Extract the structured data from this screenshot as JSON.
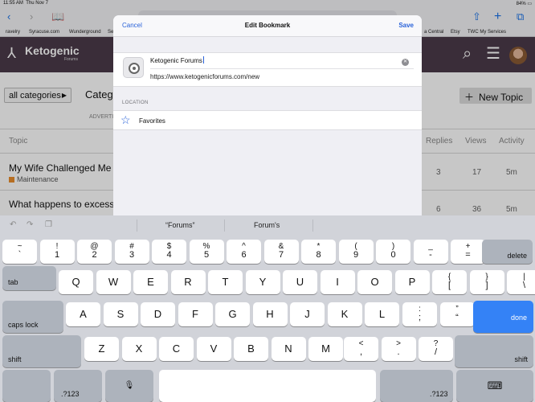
{
  "status_bar": {
    "time": "11:55 AM",
    "date": "Thu Nov 7",
    "battery": "84%"
  },
  "toolbar": {
    "back_icon": "chevron-left-icon",
    "forward_icon": "chevron-right-icon",
    "bookmarks_icon": "book-icon",
    "share_icon": "share-icon",
    "new_tab_icon": "plus-icon",
    "tabs_icon": "tabs-icon"
  },
  "favorites_bar": [
    "ravelry",
    "Syracuse.com",
    "Wunderground",
    "Se",
    "a Central",
    "Etsy",
    "TWC My Services"
  ],
  "site": {
    "brand": "Ketogenic",
    "brand_sub": "Forums"
  },
  "page": {
    "category_button": "all categories",
    "category_heading": "Categ",
    "advert": "ADVERTI",
    "new_topic": "New Topic",
    "columns": {
      "topic": "Topic",
      "replies": "Replies",
      "views": "Views",
      "activity": "Activity"
    },
    "rows": [
      {
        "title": "My Wife Challenged Me",
        "tag": "Maintenance",
        "replies": "3",
        "views": "17",
        "activity": "5m"
      },
      {
        "title": "What happens to excess",
        "replies": "6",
        "views": "36",
        "activity": "5m"
      }
    ]
  },
  "modal": {
    "cancel": "Cancel",
    "title": "Edit Bookmark",
    "save": "Save",
    "bookmark_name": "Ketogenic Forums",
    "bookmark_url": "https://www.ketogenicforums.com/new",
    "location_label": "LOCATION",
    "location_value": "Favorites"
  },
  "keyboard": {
    "suggestions": [
      "“Forums”",
      "Forum's"
    ],
    "row1": [
      [
        "~",
        "`"
      ],
      [
        "!",
        "1"
      ],
      [
        "@",
        "2"
      ],
      [
        "#",
        "3"
      ],
      [
        "$",
        "4"
      ],
      [
        "%",
        "5"
      ],
      [
        "^",
        "6"
      ],
      [
        "&",
        "7"
      ],
      [
        "*",
        "8"
      ],
      [
        "(",
        "9"
      ],
      [
        ")",
        "0"
      ],
      [
        "_",
        "-"
      ],
      [
        "+",
        "="
      ]
    ],
    "row2": [
      "Q",
      "W",
      "E",
      "R",
      "T",
      "Y",
      "U",
      "I",
      "O",
      "P"
    ],
    "row2_extra": [
      [
        "{",
        "["
      ],
      [
        "}",
        "]"
      ],
      [
        "|",
        "\\"
      ]
    ],
    "row3": [
      "A",
      "S",
      "D",
      "F",
      "G",
      "H",
      "J",
      "K",
      "L"
    ],
    "row3_extra": [
      [
        ":",
        ";"
      ],
      [
        "”",
        "“"
      ]
    ],
    "row4": [
      "Z",
      "X",
      "C",
      "V",
      "B",
      "N",
      "M"
    ],
    "row4_extra": [
      [
        "<",
        ","
      ],
      [
        ">",
        "."
      ],
      [
        "?",
        "/"
      ]
    ],
    "delete": "delete",
    "tab": "tab",
    "caps": "caps lock",
    "done": "done",
    "shift": "shift",
    "num": ".?123"
  }
}
